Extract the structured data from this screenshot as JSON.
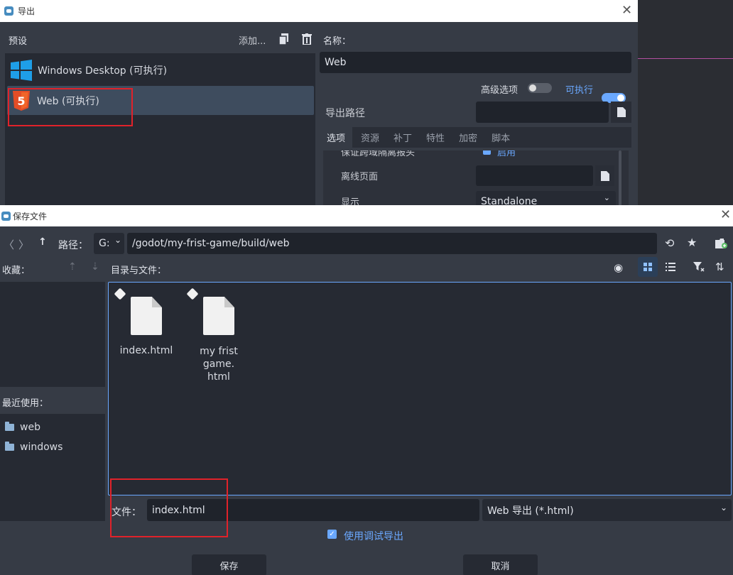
{
  "export": {
    "title": "导出",
    "presets_label": "预设",
    "add_label": "添加...",
    "presets": [
      {
        "label": "Windows Desktop (可执行)"
      },
      {
        "label": "Web (可执行)"
      }
    ],
    "name_label": "名称：",
    "name_value": "Web",
    "advanced_label": "高级选项",
    "runnable_label": "可执行",
    "export_path_label": "导出路径",
    "tabs": [
      "选项",
      "资源",
      "补丁",
      "特性",
      "加密",
      "脚本"
    ],
    "partial_option": "保证跨域隔离报头",
    "enabled_label": "启用",
    "offline_label": "离线页面",
    "display_label": "显示",
    "display_value": "Standalone"
  },
  "save": {
    "title": "保存文件",
    "path_label": "路径：",
    "drive": "G:",
    "path_value": "/godot/my-frist-game/build/web",
    "favorites_label": "收藏：",
    "dirs_files_label": "目录与文件：",
    "recent_label": "最近使用：",
    "recent": [
      "web",
      "windows"
    ],
    "files": [
      {
        "name": "index.html"
      },
      {
        "name": "my frist game.\nhtml"
      }
    ],
    "file_label": "文件：",
    "file_value": "index.html",
    "filter_value": "Web 导出 (*.html)",
    "debug_label": "使用调试导出",
    "save_button": "保存",
    "cancel_button": "取消"
  },
  "colors": {
    "accent": "#6aa8ff",
    "highlight_box": "#e0222a",
    "selected_row": "#3e4c5e"
  }
}
